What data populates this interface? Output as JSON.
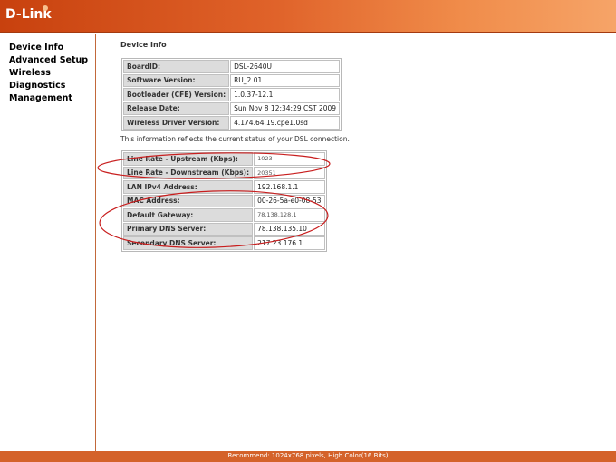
{
  "header": {
    "logo_text": "D-Link"
  },
  "sidebar": {
    "items": [
      {
        "label": "Device Info"
      },
      {
        "label": "Advanced Setup"
      },
      {
        "label": "Wireless"
      },
      {
        "label": "Diagnostics"
      },
      {
        "label": "Management"
      }
    ]
  },
  "main": {
    "title": "Device Info",
    "device_table": [
      {
        "label": "BoardID:",
        "value": "DSL-2640U"
      },
      {
        "label": "Software Version:",
        "value": "RU_2.01"
      },
      {
        "label": "Bootloader (CFE) Version:",
        "value": "1.0.37-12.1"
      },
      {
        "label": "Release Date:",
        "value": "Sun Nov 8 12:34:29 CST 2009"
      },
      {
        "label": "Wireless Driver Version:",
        "value": "4.174.64.19.cpe1.0sd"
      }
    ],
    "status_note": "This information reflects the current status of your DSL connection.",
    "connection_table": [
      {
        "label": "Line Rate - Upstream (Kbps):",
        "value": "1023"
      },
      {
        "label": "Line Rate - Downstream (Kbps):",
        "value": "20351"
      },
      {
        "label": "LAN IPv4 Address:",
        "value": "192.168.1.1"
      },
      {
        "label": "MAC Address:",
        "value": "00-26-5a-e0-08-53"
      },
      {
        "label": "Default Gateway:",
        "value": "78.138.128.1"
      },
      {
        "label": "Primary DNS Server:",
        "value": "78.138.135.10"
      },
      {
        "label": "Secondary DNS Server:",
        "value": "217.23.176.1"
      }
    ],
    "annotation_color": "#c81e1e"
  },
  "footer": {
    "text": "Recommend: 1024x768 pixels, High Color(16 Bits)"
  },
  "colors": {
    "header_accent": "#d4622a",
    "sidebar_border": "#c2683a",
    "label_cell_bg": "#dcdcdc"
  }
}
